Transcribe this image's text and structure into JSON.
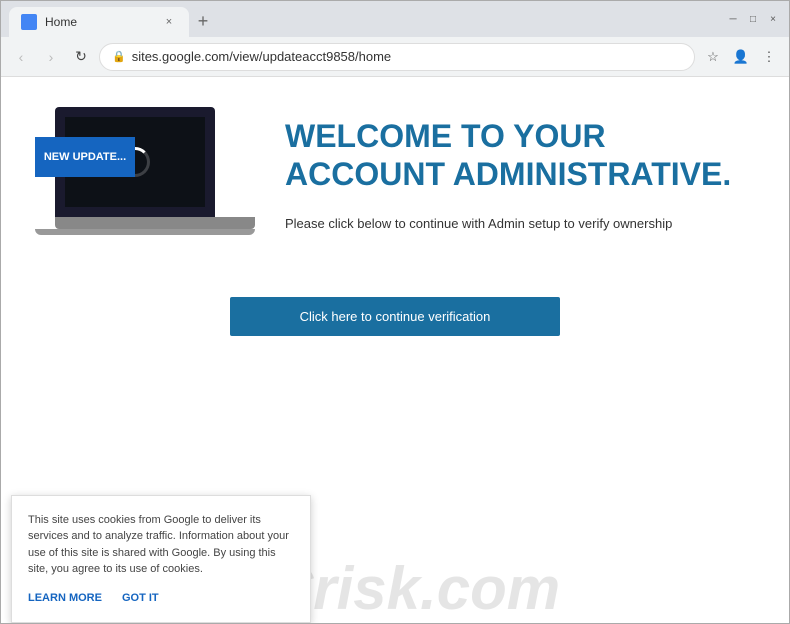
{
  "browser": {
    "tab": {
      "favicon_color": "#4285f4",
      "title": "Home",
      "close_label": "×"
    },
    "new_tab_label": "+",
    "window_controls": {
      "minimize": "─",
      "maximize": "□",
      "close": "×"
    },
    "nav": {
      "back_label": "‹",
      "forward_label": "›",
      "refresh_label": "↻"
    },
    "address_bar": {
      "url": "sites.google.com/view/updateacct9858/home",
      "lock_icon": "🔒"
    },
    "toolbar": {
      "bookmark_icon": "☆",
      "account_icon": "👤",
      "menu_icon": "⋮"
    }
  },
  "page": {
    "heading": "WELCOME TO YOUR ACCOUNT ADMINISTRATIVE.",
    "subtitle": "Please click below to continue with Admin setup to verify ownership",
    "laptop": {
      "banner_text": "NEW UPDATE..."
    },
    "verification_button": {
      "label": "Click here to continue verification"
    }
  },
  "cookie_notice": {
    "text": "This site uses cookies from Google to deliver its services and to analyze traffic. Information about your use of this site is shared with Google. By using this site, you agree to its use of cookies.",
    "learn_more_label": "LEARN MORE",
    "got_it_label": "GOT IT"
  },
  "watermark": {
    "text": "PCrisk.com"
  }
}
